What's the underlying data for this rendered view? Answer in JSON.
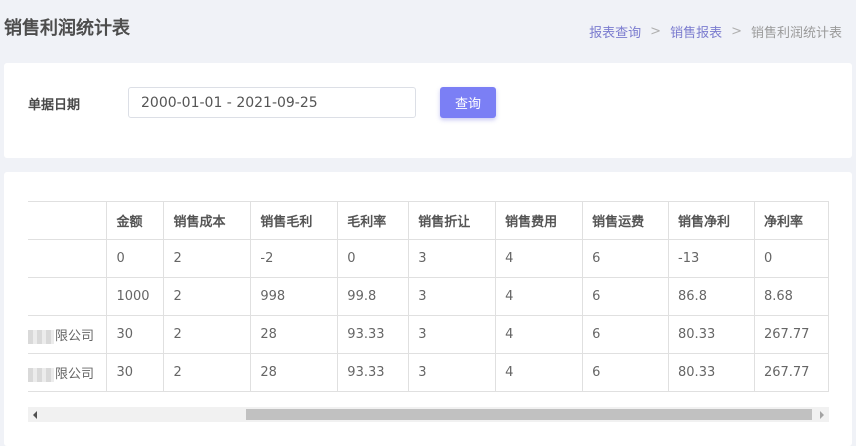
{
  "header": {
    "title": "销售利润统计表",
    "breadcrumb": {
      "item1": "报表查询",
      "item2": "销售报表",
      "current": "销售利润统计表",
      "separator": ">"
    }
  },
  "filter": {
    "label": "单据日期",
    "date_range": "2000-01-01 - 2021-09-25",
    "query_button": "查询"
  },
  "colors": {
    "accent": "#7b7ff5",
    "link": "#7b7ccf"
  },
  "table": {
    "columns": [
      "",
      "金额",
      "销售成本",
      "销售毛利",
      "毛利率",
      "销售折让",
      "销售费用",
      "销售运费",
      "销售净利",
      "净利率"
    ],
    "rows": [
      {
        "name": "",
        "cells": [
          "0",
          "2",
          "-2",
          "0",
          "3",
          "4",
          "6",
          "-13",
          "0"
        ]
      },
      {
        "name": "",
        "cells": [
          "1000",
          "2",
          "998",
          "99.8",
          "3",
          "4",
          "6",
          "86.8",
          "8.68"
        ]
      },
      {
        "name": "限公司",
        "cells": [
          "30",
          "2",
          "28",
          "93.33",
          "3",
          "4",
          "6",
          "80.33",
          "267.77"
        ]
      },
      {
        "name": "限公司",
        "cells": [
          "30",
          "2",
          "28",
          "93.33",
          "3",
          "4",
          "6",
          "80.33",
          "267.77"
        ]
      }
    ]
  }
}
